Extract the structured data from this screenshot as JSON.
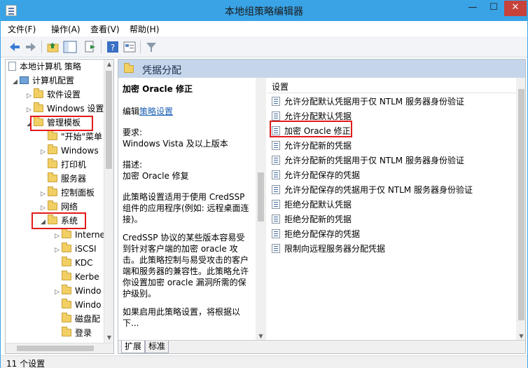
{
  "window": {
    "title": "本地组策略编辑器",
    "controls": {
      "minimize": "—",
      "maximize": "☐",
      "close": "✕"
    }
  },
  "menu": [
    "文件(F)",
    "操作(A)",
    "查看(V)",
    "帮助(H)"
  ],
  "toolbar": {
    "icons": [
      "back-icon",
      "forward-icon",
      "up-folder-icon",
      "show-tree-icon",
      "export-icon",
      "help-icon",
      "properties-icon",
      "filter-icon"
    ]
  },
  "tree": {
    "items": [
      {
        "label": "本地计算机 策略",
        "level": 0,
        "arrow": "",
        "icon": "doc"
      },
      {
        "label": "计算机配置",
        "level": 1,
        "arrow": "◢",
        "icon": "pc"
      },
      {
        "label": "软件设置",
        "level": 2,
        "arrow": "▷",
        "icon": "folder"
      },
      {
        "label": "Windows 设置",
        "level": 2,
        "arrow": "▷",
        "icon": "folder"
      },
      {
        "label": "管理模板",
        "level": 2,
        "arrow": "◢",
        "icon": "folder"
      },
      {
        "label": "\"开始\"菜单",
        "level": 3,
        "arrow": "",
        "icon": "folder"
      },
      {
        "label": "Windows",
        "level": 3,
        "arrow": "▷",
        "icon": "folder"
      },
      {
        "label": "打印机",
        "level": 3,
        "arrow": "",
        "icon": "folder"
      },
      {
        "label": "服务器",
        "level": 3,
        "arrow": "",
        "icon": "folder"
      },
      {
        "label": "控制面板",
        "level": 3,
        "arrow": "▷",
        "icon": "folder"
      },
      {
        "label": "网络",
        "level": 3,
        "arrow": "▷",
        "icon": "folder"
      },
      {
        "label": "系统",
        "level": 3,
        "arrow": "◢",
        "icon": "folder"
      },
      {
        "label": "Interne",
        "level": 4,
        "arrow": "▷",
        "icon": "folder"
      },
      {
        "label": "iSCSI",
        "level": 4,
        "arrow": "▷",
        "icon": "folder"
      },
      {
        "label": "KDC",
        "level": 4,
        "arrow": "",
        "icon": "folder"
      },
      {
        "label": "Kerbe",
        "level": 4,
        "arrow": "",
        "icon": "folder"
      },
      {
        "label": "Windo",
        "level": 4,
        "arrow": "▷",
        "icon": "folder"
      },
      {
        "label": "Windo",
        "level": 4,
        "arrow": "",
        "icon": "folder"
      },
      {
        "label": "磁盘配",
        "level": 4,
        "arrow": "",
        "icon": "folder"
      },
      {
        "label": "登录",
        "level": 4,
        "arrow": "",
        "icon": "folder"
      }
    ]
  },
  "right": {
    "header": "凭据分配",
    "description": {
      "title": "加密 Oracle 修正",
      "edit_prefix": "编辑",
      "edit_link": "策略设置",
      "requirements_label": "要求:",
      "requirements_value": "Windows Vista 及以上版本",
      "desc_label": "描述:",
      "desc_value": "加密 Oracle 修复",
      "para1": "此策略设置适用于使用 CredSSP 组件的应用程序(例如: 远程桌面连接)。",
      "para2": "CredSSP 协议的某些版本容易受到针对客户端的加密 oracle 攻击。此策略控制与易受攻击的客户端和服务器的兼容性。此策略允许你设置加密 oracle 漏洞所需的保护级别。",
      "para3": "如果启用此策略设置，将根据以下..."
    },
    "list_header": "设置",
    "settings": [
      "允许分配默认凭据用于仅 NTLM 服务器身份验证",
      "允许分配默认凭据",
      "加密 Oracle 修正",
      "允许分配新的凭据",
      "允许分配新的凭据用于仅 NTLM 服务器身份验证",
      "允许分配保存的凭据",
      "允许分配保存的凭据用于仅 NTLM 服务器身份验证",
      "拒绝分配默认凭据",
      "拒绝分配新的凭据",
      "拒绝分配保存的凭据",
      "限制向远程服务器分配凭据"
    ],
    "tabs": [
      "扩展",
      "标准"
    ]
  },
  "status": "11 个设置",
  "colors": {
    "titlebar": "#39a3e6",
    "header": "#c6d6ea",
    "highlight": "#e21b1b"
  }
}
